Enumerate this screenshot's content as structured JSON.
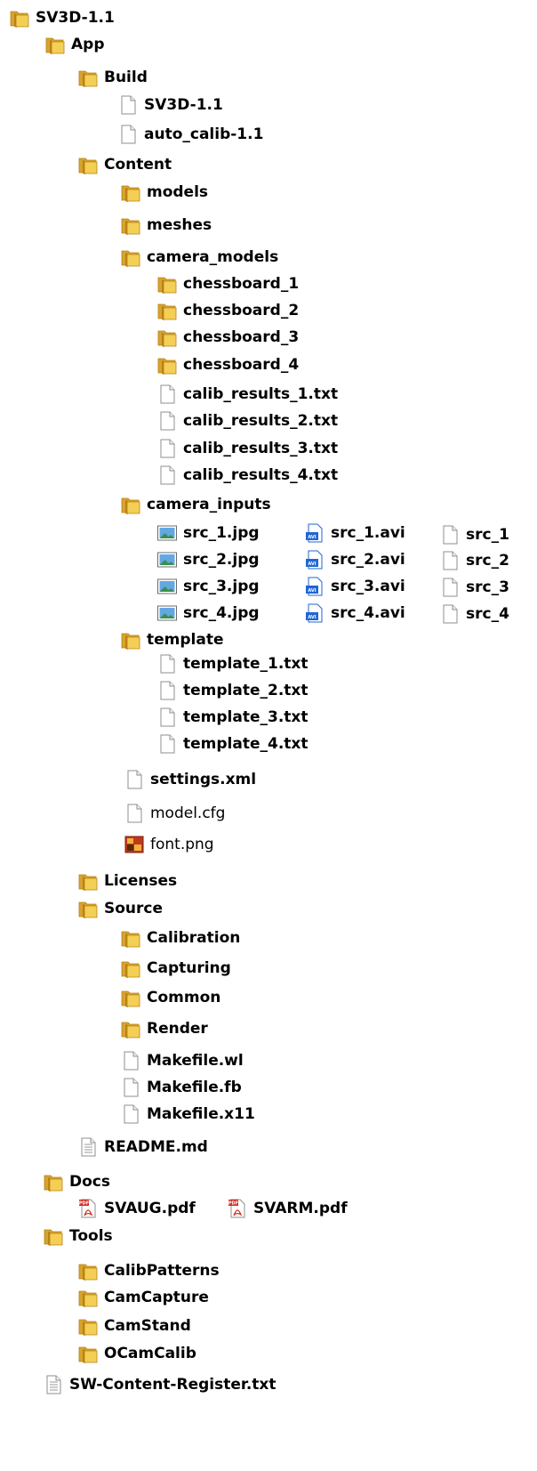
{
  "colors": {
    "folder_back": "#d6a330",
    "folder_front": "#f4cf55",
    "folder_dark": "#b98212",
    "file_border": "#8f8f8f",
    "video_blue": "#1f66d6",
    "pdf_red": "#d12b1f",
    "image_green": "#3b8f4c",
    "image_blue": "#63a8e3"
  },
  "tree": {
    "items": [
      {
        "id": "sv3d-1-1",
        "label": "SV3D-1.1",
        "icon": "folder-icon"
      },
      {
        "id": "app",
        "label": "App",
        "icon": "folder-icon"
      },
      {
        "id": "build",
        "label": "Build",
        "icon": "folder-icon"
      },
      {
        "id": "sv3d-1-1-binary",
        "label": "SV3D-1.1",
        "icon": "file-icon"
      },
      {
        "id": "auto-calib-1-1",
        "label": "auto_calib-1.1",
        "icon": "file-icon"
      },
      {
        "id": "content",
        "label": "Content",
        "icon": "folder-icon"
      },
      {
        "id": "models",
        "label": "models",
        "icon": "folder-icon"
      },
      {
        "id": "meshes",
        "label": "meshes",
        "icon": "folder-icon"
      },
      {
        "id": "camera-models",
        "label": "camera_models",
        "icon": "folder-icon"
      },
      {
        "id": "chessboard-1",
        "label": "chessboard_1",
        "icon": "folder-icon"
      },
      {
        "id": "chessboard-2",
        "label": "chessboard_2",
        "icon": "folder-icon"
      },
      {
        "id": "chessboard-3",
        "label": "chessboard_3",
        "icon": "folder-icon"
      },
      {
        "id": "chessboard-4",
        "label": "chessboard_4",
        "icon": "folder-icon"
      },
      {
        "id": "calib-results-1",
        "label": "calib_results_1.txt",
        "icon": "file-icon"
      },
      {
        "id": "calib-results-2",
        "label": "calib_results_2.txt",
        "icon": "file-icon"
      },
      {
        "id": "calib-results-3",
        "label": "calib_results_3.txt",
        "icon": "file-icon"
      },
      {
        "id": "calib-results-4",
        "label": "calib_results_4.txt",
        "icon": "file-icon"
      },
      {
        "id": "camera-inputs",
        "label": "camera_inputs",
        "icon": "folder-icon"
      },
      {
        "id": "src-1-jpg",
        "label": "src_1.jpg",
        "icon": "image-file-icon"
      },
      {
        "id": "src-2-jpg",
        "label": "src_2.jpg",
        "icon": "image-file-icon"
      },
      {
        "id": "src-3-jpg",
        "label": "src_3.jpg",
        "icon": "image-file-icon"
      },
      {
        "id": "src-4-jpg",
        "label": "src_4.jpg",
        "icon": "image-file-icon"
      },
      {
        "id": "src-1-avi",
        "label": "src_1.avi",
        "icon": "video-file-icon"
      },
      {
        "id": "src-2-avi",
        "label": "src_2.avi",
        "icon": "video-file-icon"
      },
      {
        "id": "src-3-avi",
        "label": "src_3.avi",
        "icon": "video-file-icon"
      },
      {
        "id": "src-4-avi",
        "label": "src_4.avi",
        "icon": "video-file-icon"
      },
      {
        "id": "src-1",
        "label": "src_1",
        "icon": "file-icon"
      },
      {
        "id": "src-2",
        "label": "src_2",
        "icon": "file-icon"
      },
      {
        "id": "src-3",
        "label": "src_3",
        "icon": "file-icon"
      },
      {
        "id": "src-4",
        "label": "src_4",
        "icon": "file-icon"
      },
      {
        "id": "template",
        "label": "template",
        "icon": "folder-icon"
      },
      {
        "id": "template-1",
        "label": "template_1.txt",
        "icon": "file-icon"
      },
      {
        "id": "template-2",
        "label": "template_2.txt",
        "icon": "file-icon"
      },
      {
        "id": "template-3",
        "label": "template_3.txt",
        "icon": "file-icon"
      },
      {
        "id": "template-4",
        "label": "template_4.txt",
        "icon": "file-icon"
      },
      {
        "id": "settings-xml",
        "label": "settings.xml",
        "icon": "file-icon"
      },
      {
        "id": "model-cfg",
        "label": "model.cfg",
        "icon": "file-icon"
      },
      {
        "id": "font-png",
        "label": "font.png",
        "icon": "png-file-icon"
      },
      {
        "id": "licenses",
        "label": "Licenses",
        "icon": "folder-icon"
      },
      {
        "id": "source",
        "label": "Source",
        "icon": "folder-icon"
      },
      {
        "id": "calibration",
        "label": "Calibration",
        "icon": "folder-icon"
      },
      {
        "id": "capturing",
        "label": "Capturing",
        "icon": "folder-icon"
      },
      {
        "id": "common",
        "label": "Common",
        "icon": "folder-icon"
      },
      {
        "id": "render",
        "label": "Render",
        "icon": "folder-icon"
      },
      {
        "id": "makefile-wl",
        "label": "Makefile.wl",
        "icon": "file-icon"
      },
      {
        "id": "makefile-fb",
        "label": "Makefile.fb",
        "icon": "file-icon"
      },
      {
        "id": "makefile-x11",
        "label": "Makefile.x11",
        "icon": "file-icon"
      },
      {
        "id": "readme-md",
        "label": "README.md",
        "icon": "text-file-icon"
      },
      {
        "id": "docs",
        "label": "Docs",
        "icon": "folder-icon"
      },
      {
        "id": "svaug-pdf",
        "label": "SVAUG.pdf",
        "icon": "pdf-file-icon"
      },
      {
        "id": "svarm-pdf",
        "label": "SVARM.pdf",
        "icon": "pdf-file-icon"
      },
      {
        "id": "tools",
        "label": "Tools",
        "icon": "folder-icon"
      },
      {
        "id": "calibpatterns",
        "label": "CalibPatterns",
        "icon": "folder-icon"
      },
      {
        "id": "camcapture",
        "label": "CamCapture",
        "icon": "folder-icon"
      },
      {
        "id": "camstand",
        "label": "CamStand",
        "icon": "folder-icon"
      },
      {
        "id": "ocamcalib",
        "label": "OCamCalib",
        "icon": "folder-icon"
      },
      {
        "id": "sw-content-register",
        "label": "SW-Content-Register.txt",
        "icon": "text-file-icon"
      }
    ]
  }
}
